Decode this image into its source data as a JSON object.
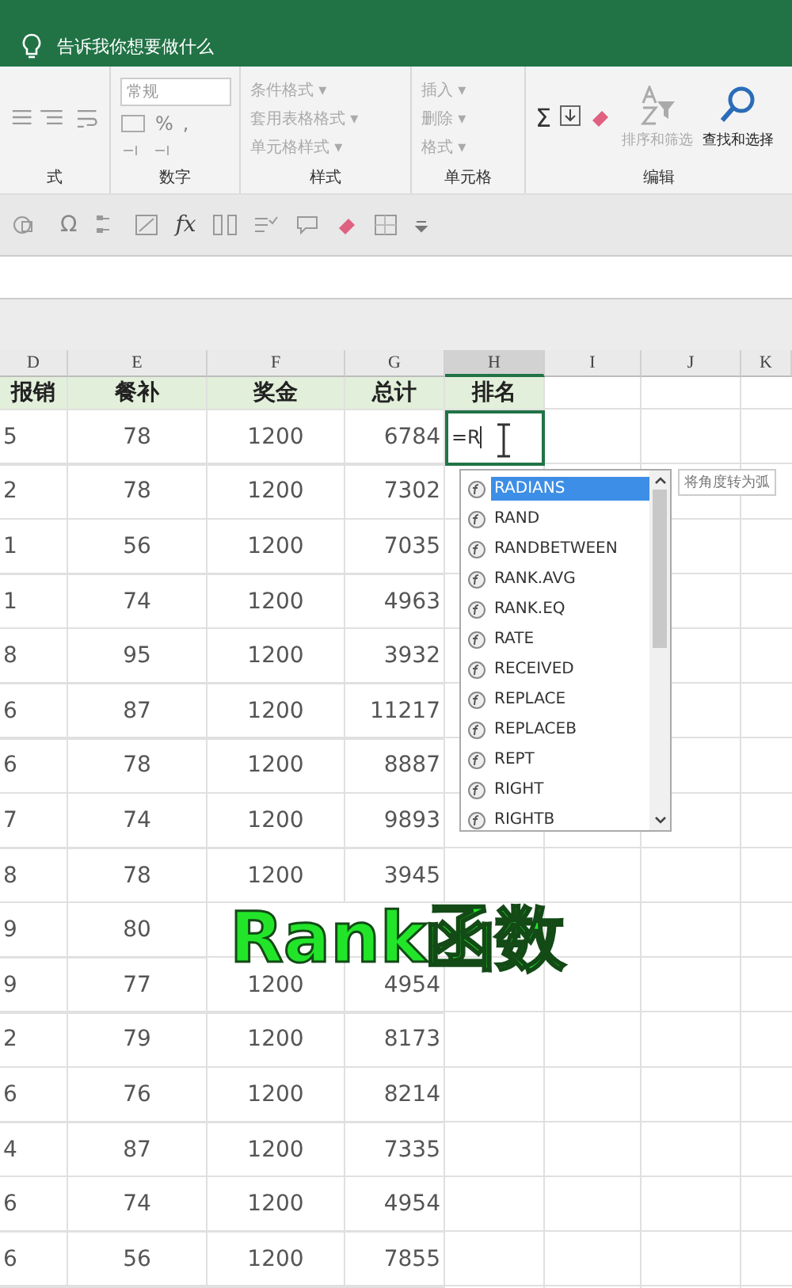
{
  "tell_me": {
    "placeholder": "告诉我你想要做什么"
  },
  "ribbon": {
    "alignment": {
      "label": "式"
    },
    "number": {
      "format": "常规",
      "percent": "%",
      "comma": ",",
      "label": "数字"
    },
    "styles": {
      "items": [
        "条件格式 ▾",
        "套用表格格式 ▾",
        "单元格样式 ▾"
      ],
      "label": "样式"
    },
    "cells": {
      "items": [
        "插入 ▾",
        "删除 ▾",
        "格式 ▾"
      ],
      "label": "单元格"
    },
    "editing": {
      "sum": "Σ",
      "sort": "排序和筛选",
      "find": "查找和选择",
      "label": "编辑"
    }
  },
  "toolbar": {
    "symbol": "Ω",
    "function": "fx"
  },
  "sheet": {
    "columns": [
      {
        "label": "D",
        "selected": false
      },
      {
        "label": "E",
        "selected": false
      },
      {
        "label": "F",
        "selected": false
      },
      {
        "label": "G",
        "selected": false
      },
      {
        "label": "H",
        "selected": true
      },
      {
        "label": "I",
        "selected": false
      },
      {
        "label": "J",
        "selected": false
      },
      {
        "label": "K",
        "selected": false
      }
    ],
    "header_row": [
      "报销",
      "餐补",
      "奖金",
      "总计",
      "排名"
    ],
    "active_cell": {
      "value": "=R"
    },
    "rows": [
      [
        "5",
        "78",
        "1200",
        "6784"
      ],
      [
        "2",
        "78",
        "1200",
        "7302"
      ],
      [
        "1",
        "56",
        "1200",
        "7035"
      ],
      [
        "1",
        "74",
        "1200",
        "4963"
      ],
      [
        "8",
        "95",
        "1200",
        "3932"
      ],
      [
        "6",
        "87",
        "1200",
        "11217"
      ],
      [
        "6",
        "78",
        "1200",
        "8887"
      ],
      [
        "7",
        "74",
        "1200",
        "9893"
      ],
      [
        "8",
        "78",
        "1200",
        "3945"
      ],
      [
        "9",
        "80"
      ],
      [
        "9",
        "77",
        "1200",
        "4954"
      ],
      [
        "2",
        "79",
        "1200",
        "8173"
      ],
      [
        "6",
        "76",
        "1200",
        "8214"
      ],
      [
        "4",
        "87",
        "1200",
        "7335"
      ],
      [
        "6",
        "74",
        "1200",
        "4954"
      ],
      [
        "6",
        "56",
        "1200",
        "7855"
      ]
    ]
  },
  "autocomplete": {
    "items": [
      {
        "label": "RADIANS",
        "selected": true
      },
      {
        "label": "RAND",
        "selected": false
      },
      {
        "label": "RANDBETWEEN",
        "selected": false
      },
      {
        "label": "RANK.AVG",
        "selected": false
      },
      {
        "label": "RANK.EQ",
        "selected": false
      },
      {
        "label": "RATE",
        "selected": false
      },
      {
        "label": "RECEIVED",
        "selected": false
      },
      {
        "label": "REPLACE",
        "selected": false
      },
      {
        "label": "REPLACEB",
        "selected": false
      },
      {
        "label": "REPT",
        "selected": false
      },
      {
        "label": "RIGHT",
        "selected": false
      },
      {
        "label": "RIGHTB",
        "selected": false
      }
    ],
    "tooltip": "将角度转为弧"
  },
  "caption": "Rank函数"
}
